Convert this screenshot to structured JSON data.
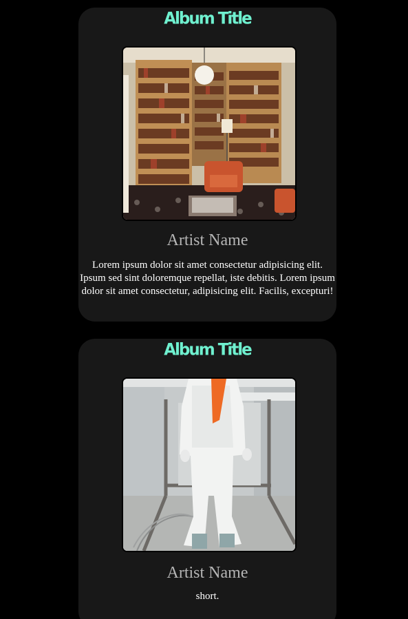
{
  "cards": [
    {
      "album_title": "Album Title",
      "artist_name": "Artist Name",
      "description": "Lorem ipsum dolor sit amet consectetur adipisicing elit. Ipsum sed sint doloremque repellat, iste debitis. Lorem ipsum dolor sit amet consectetur, adipisicing elit. Facilis, excepturi!",
      "cover_icon": "library-bookshelves-image"
    },
    {
      "album_title": "Album Title",
      "artist_name": "Artist Name",
      "description": "short.",
      "cover_icon": "white-suit-painter-image"
    }
  ],
  "colors": {
    "page_background": "#000000",
    "card_background": "#181818",
    "title_accent": "#6ff0cf",
    "artist_text": "#b5b5b5",
    "description_text": "#ffffff"
  }
}
